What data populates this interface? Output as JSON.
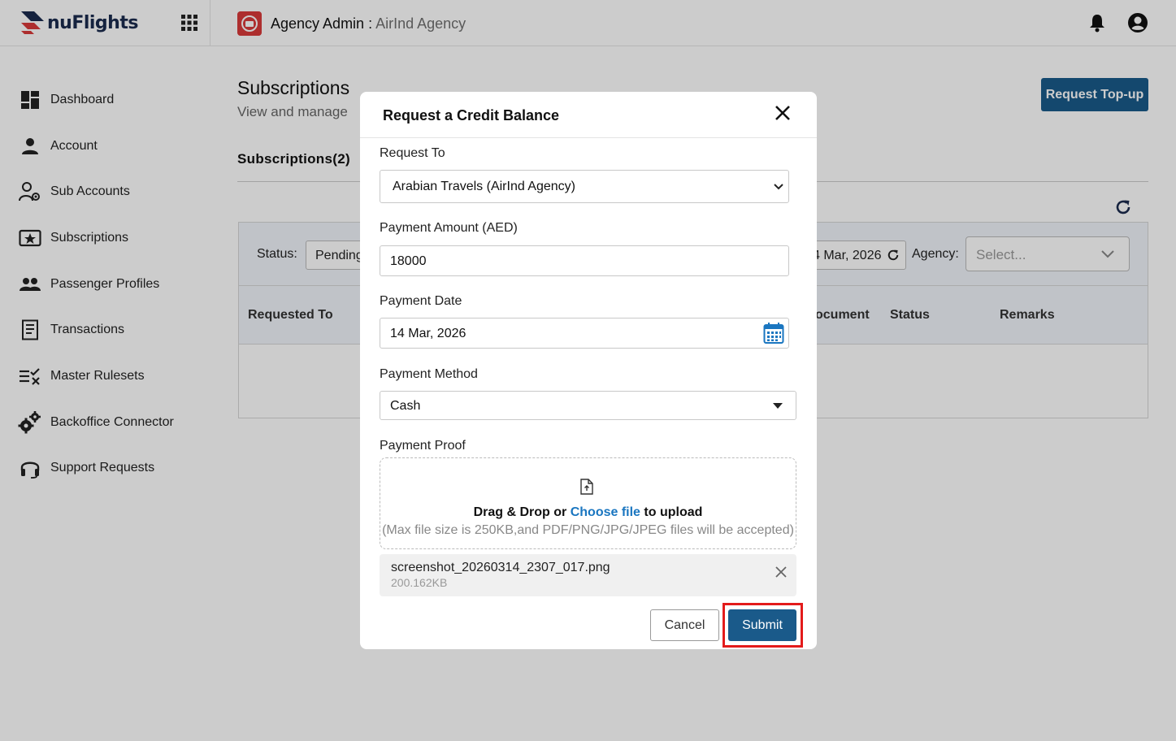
{
  "app": {
    "logo_text": "nuFlights"
  },
  "header": {
    "title_prefix": "Agency Admin",
    "title_sep": " : ",
    "agency_name": "AirInd Agency",
    "icons": [
      "apps-grid-icon",
      "agency-icon",
      "bell-icon",
      "user-circle-icon"
    ]
  },
  "sidebar": {
    "items": [
      {
        "label": "Dashboard",
        "icon": "dashboard-icon"
      },
      {
        "label": "Account",
        "icon": "person-icon"
      },
      {
        "label": "Sub Accounts",
        "icon": "sub-accounts-icon"
      },
      {
        "label": "Subscriptions",
        "icon": "subscriptions-icon"
      },
      {
        "label": "Passenger Profiles",
        "icon": "people-icon"
      },
      {
        "label": "Transactions",
        "icon": "receipt-icon"
      },
      {
        "label": "Master Rulesets",
        "icon": "rules-icon"
      },
      {
        "label": "Backoffice Connector",
        "icon": "gears-icon"
      },
      {
        "label": "Support Requests",
        "icon": "headset-icon"
      }
    ]
  },
  "main": {
    "title": "Subscriptions",
    "subtitle": "View and manage",
    "topup_button": "Request Top-up",
    "tab_label": "Subscriptions(2)",
    "filters": {
      "status_label": "Status:",
      "status_value": "Pending",
      "date_value": "4 Mar, 2026",
      "agency_label": "Agency:",
      "agency_placeholder": "Select..."
    },
    "columns": [
      "Requested To",
      "ocument",
      "Status",
      "Remarks"
    ]
  },
  "modal": {
    "title": "Request a Credit Balance",
    "request_to_label": "Request To",
    "request_to_value": "Arabian Travels (AirInd Agency)",
    "amount_label": "Payment Amount (AED)",
    "amount_value": "18000",
    "date_label": "Payment Date",
    "date_value": "14 Mar, 2026",
    "method_label": "Payment Method",
    "method_value": "Cash",
    "proof_label": "Payment Proof",
    "dz_drag": "Drag & Drop or ",
    "dz_choose": "Choose file",
    "dz_upload": " to upload",
    "dz_note": "(Max file size is 250KB,and PDF/PNG/JPG/JPEG files will be accepted)",
    "file_name": "screenshot_20260314_2307_017.png",
    "file_size": "200.162KB",
    "cancel_label": "Cancel",
    "submit_label": "Submit"
  },
  "colors": {
    "primary": "#1a5a8a",
    "link": "#1a76c0",
    "highlight": "#e31b1b",
    "agency_icon": "#d93a3a"
  }
}
